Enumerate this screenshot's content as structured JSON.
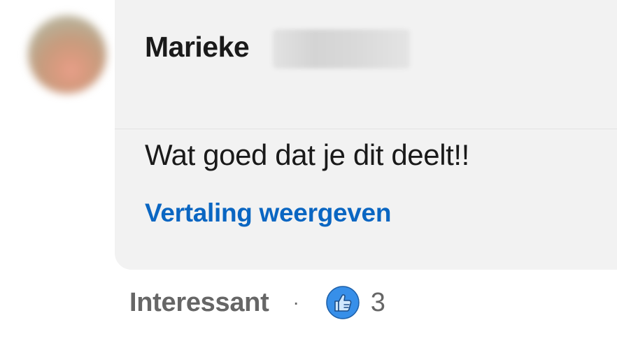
{
  "comment": {
    "author_name": "Marieke",
    "text": "Wat goed dat je dit deelt!!",
    "translate_label": "Vertaling weergeven"
  },
  "actions": {
    "reaction_label": "Interessant",
    "separator": "·",
    "reaction_icon": "like-icon",
    "reaction_count": "3"
  },
  "colors": {
    "bubble_bg": "#f2f2f2",
    "link": "#0a66c2",
    "secondary_text": "#666666",
    "like_blue": "#378fe9"
  }
}
